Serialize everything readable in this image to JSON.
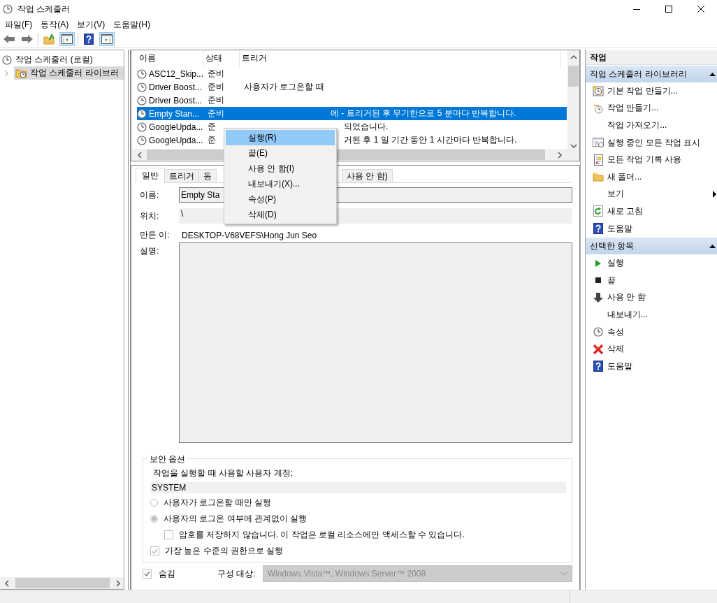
{
  "window": {
    "title": "작업 스케줄러"
  },
  "menu": [
    "파일(F)",
    "동작(A)",
    "보기(V)",
    "도움말(H)"
  ],
  "toolbar": [
    {
      "kind": "back",
      "on": false
    },
    {
      "kind": "forward",
      "on": false
    },
    {
      "kind": "up",
      "on": false
    },
    {
      "kind": "tree-pane",
      "on": true
    },
    {
      "kind": "help",
      "on": false
    },
    {
      "kind": "action-pane",
      "on": true
    }
  ],
  "tree": [
    {
      "label": "작업 스케줄러 (로컬)",
      "selected": false,
      "children": [
        {
          "label": "작업 스케줄러 라이브러",
          "selected": true,
          "expanded": false
        }
      ]
    }
  ],
  "task_list": {
    "columns": [
      "이름",
      "상태",
      "트리거"
    ],
    "rows": [
      {
        "name": "ASC12_Skip...",
        "status": "준비",
        "selected": false
      },
      {
        "name": "Driver Boost...",
        "status": "준비",
        "trigger": "사용자가 로그온할 때",
        "selected": false
      },
      {
        "name": "Driver Boost...",
        "status": "준비",
        "selected": false
      },
      {
        "name": "Empty Stan...",
        "status": "준비",
        "trigger": "에 - 트리거된 후 무기한으로 5 분마다 반복합니다.",
        "selected": true
      },
      {
        "name": "GoogleUpda...",
        "status": "준",
        "trigger": "되었습니다.",
        "selected": false
      },
      {
        "name": "GoogleUpda...",
        "status": "준",
        "trigger": "거된 후 1 일 기간 동안 1 시간마다 반복합니다.",
        "selected": false
      }
    ]
  },
  "context_menu": [
    {
      "label": "실행(R)",
      "selected": true
    },
    {
      "label": "끝(E)",
      "selected": false
    },
    {
      "label": "사용 안 함(I)",
      "selected": false
    },
    {
      "label": "내보내기(X)...",
      "selected": false
    },
    {
      "label": "속성(P)",
      "selected": false
    },
    {
      "label": "삭제(D)",
      "selected": false
    }
  ],
  "detail": {
    "tabs": [
      {
        "label": "일반",
        "selected": true
      },
      {
        "label": "트리거",
        "selected": false
      },
      {
        "label": "동",
        "selected": false
      },
      {
        "label": "사용 안 함)",
        "selected": false
      }
    ],
    "fields": [
      {
        "kind": "input",
        "label": "이름:",
        "value": "Empty Sta"
      },
      {
        "kind": "readonly",
        "label": "위치:",
        "value": "\\"
      },
      {
        "kind": "text",
        "label": "만든 이:",
        "value": "DESKTOP-V68VEFS\\Hong Jun Seo"
      },
      {
        "kind": "textarea",
        "label": "설명:"
      }
    ],
    "security": {
      "title": "보안 옵션",
      "account_label": "작업을 실행할 때 사용할 사용자 계정:",
      "account": "SYSTEM",
      "options": [
        {
          "kind": "radio",
          "label": "사용자가 로그온할 때만 실행",
          "checked": false
        },
        {
          "kind": "radio",
          "label": "사용자의 로그온 여부에 관계없이 실행",
          "checked": true
        },
        {
          "kind": "subcheck",
          "label": "암호를 저장하지 않습니다. 이 작업은 로컬 리소스에만 액세스할 수 있습니다.",
          "checked": false
        },
        {
          "kind": "checkbox",
          "label": "가장 높은 수준의 권한으로 실행",
          "checked": true
        }
      ]
    },
    "hidden": {
      "label": "숨김",
      "checked": true
    },
    "configure": {
      "label": "구성 대상:",
      "value": "Windows Vista™, Windows Server™ 2008"
    }
  },
  "actions": {
    "title": "작업",
    "sections": [
      {
        "title": "작업 스케줄러 라이브러리",
        "expanded": true,
        "items": [
          {
            "kind": "wizard",
            "label": "기본 작업 만들기..."
          },
          {
            "kind": "create",
            "label": "작업 만들기..."
          },
          {
            "kind": "plain",
            "label": "작업 가져오기..."
          },
          {
            "kind": "running",
            "label": "실행 중인 모든 작업 표시"
          },
          {
            "kind": "history",
            "label": "모든 작업 기록 사용"
          },
          {
            "kind": "folder",
            "label": "새 폴더..."
          },
          {
            "kind": "submenu",
            "label": "보기"
          },
          {
            "kind": "refresh",
            "label": "새로 고침"
          },
          {
            "kind": "help",
            "label": "도움말"
          }
        ]
      },
      {
        "title": "선택한 항목",
        "expanded": true,
        "items": [
          {
            "kind": "run",
            "label": "실행"
          },
          {
            "kind": "stop",
            "label": "끝"
          },
          {
            "kind": "disable",
            "label": "사용 안 함"
          },
          {
            "kind": "plain",
            "label": "내보내기..."
          },
          {
            "kind": "properties",
            "label": "속성"
          },
          {
            "kind": "delete",
            "label": "삭제"
          },
          {
            "kind": "help",
            "label": "도움말"
          }
        ]
      }
    ]
  }
}
